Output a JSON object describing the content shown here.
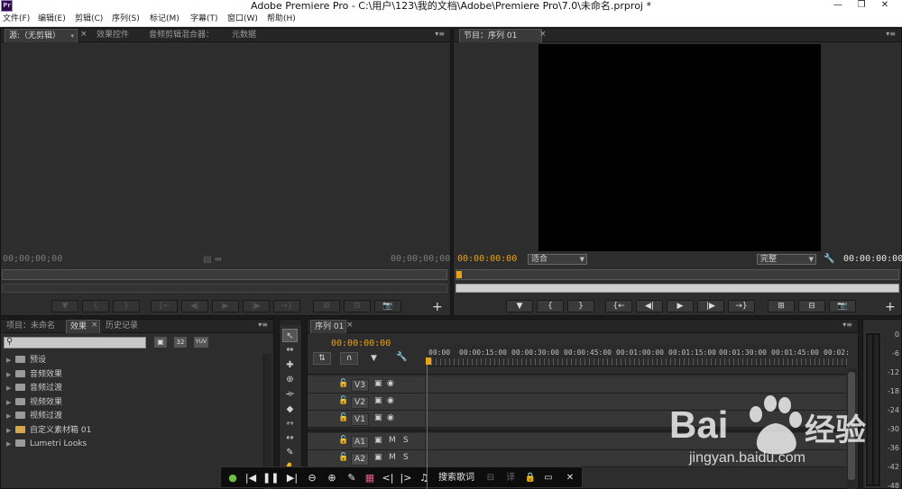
{
  "window": {
    "title": "Adobe Premiere Pro - C:\\用户\\123\\我的文档\\Adobe\\Premiere Pro\\7.0\\未命名.prproj *",
    "logo": "Pr",
    "controls": {
      "minimize": "—",
      "maximize": "❐",
      "close": "✕"
    }
  },
  "menu": {
    "items": [
      "文件(F)",
      "编辑(E)",
      "剪辑(C)",
      "序列(S)",
      "标记(M)",
      "字幕(T)",
      "窗口(W)",
      "帮助(H)"
    ]
  },
  "source_panel": {
    "tabs": [
      "源:（无剪辑）",
      "效果控件",
      "音频剪辑混合器：",
      "元数据"
    ],
    "close_icon": "×",
    "menu_icon": "▾≡",
    "timecode_left": "00;00;00;00",
    "timecode_right": "00;00;00;00",
    "center_icons": "▤ ⇹",
    "add_icon": "+"
  },
  "program_panel": {
    "tab": "节目：序列 01",
    "close_icon": "×",
    "menu_icon": "▾≡",
    "timecode_left": "00:00:00:00",
    "fit_label": "适合",
    "quality_label": "完整",
    "wrench_icon": "🔧",
    "timecode_right": "00:00:00:00",
    "add_icon": "+"
  },
  "transport_icons": [
    "▼",
    "{",
    "}",
    "{←",
    "◀|",
    "▶",
    "|▶",
    "→}",
    "⊞",
    "⊟",
    "📷"
  ],
  "project_panel": {
    "tabs": [
      "项目：未命名",
      "效果",
      "历史记录"
    ],
    "close_icon": "×",
    "menu_icon": "▾≡",
    "search_icon": "⚲",
    "search_value": "",
    "toolbar_icons": [
      "▣",
      "32",
      "YUV"
    ],
    "items": [
      {
        "label": "预设",
        "folder": "plain"
      },
      {
        "label": "音频效果",
        "folder": "plain"
      },
      {
        "label": "音频过渡",
        "folder": "plain"
      },
      {
        "label": "视频效果",
        "folder": "plain"
      },
      {
        "label": "视频过渡",
        "folder": "plain"
      },
      {
        "label": "自定义素材箱 01",
        "folder": "gold"
      },
      {
        "label": "Lumetri Looks",
        "folder": "plain"
      }
    ]
  },
  "tools": [
    "↖",
    "⇔",
    "✚",
    "⊕",
    "⟛",
    "◆",
    "⇿",
    "↔",
    "✎",
    "✋"
  ],
  "timeline": {
    "tab": "序列 01",
    "close_icon": "×",
    "menu_icon": "▾≡",
    "timecode": "00:00:00:00",
    "ruler_labels": [
      "00:00",
      "00:00:15:00",
      "00:00:30:00",
      "00:00:45:00",
      "00:01:00:00",
      "00:01:15:00",
      "00:01:30:00",
      "00:01:45:00",
      "00:02:"
    ],
    "header_icons": [
      "⇅",
      "∩",
      "▼",
      "🔧"
    ],
    "tracks": [
      {
        "name": "V3",
        "type": "video"
      },
      {
        "name": "V2",
        "type": "video"
      },
      {
        "name": "V1",
        "type": "video"
      },
      {
        "name": "A1",
        "type": "audio"
      },
      {
        "name": "A2",
        "type": "audio"
      }
    ],
    "track_icons": {
      "lock": "🔓",
      "sync": "▣",
      "eye": "◉",
      "mute": "M",
      "solo": "S"
    }
  },
  "meter": {
    "labels": [
      "0",
      "-6",
      "-12",
      "-18",
      "-24",
      "-30",
      "-36",
      "-42",
      "-48"
    ]
  },
  "floating_toolbar": {
    "icons": [
      "●",
      "|◀",
      "❚❚",
      "▶|",
      "⊖",
      "⊕",
      "✎",
      "▦",
      "<|",
      "|>",
      "♫"
    ],
    "search_label": "搜索歌词",
    "extra_icons": [
      "⊟",
      "译",
      "🔒",
      "▭",
      "✕"
    ]
  },
  "watermark": {
    "brand": "Bai",
    "brand_suffix": "经验",
    "url": "jingyan.baidu.com"
  },
  "colors": {
    "timecode_orange": "#e7a218",
    "playhead": "#d2492a"
  }
}
